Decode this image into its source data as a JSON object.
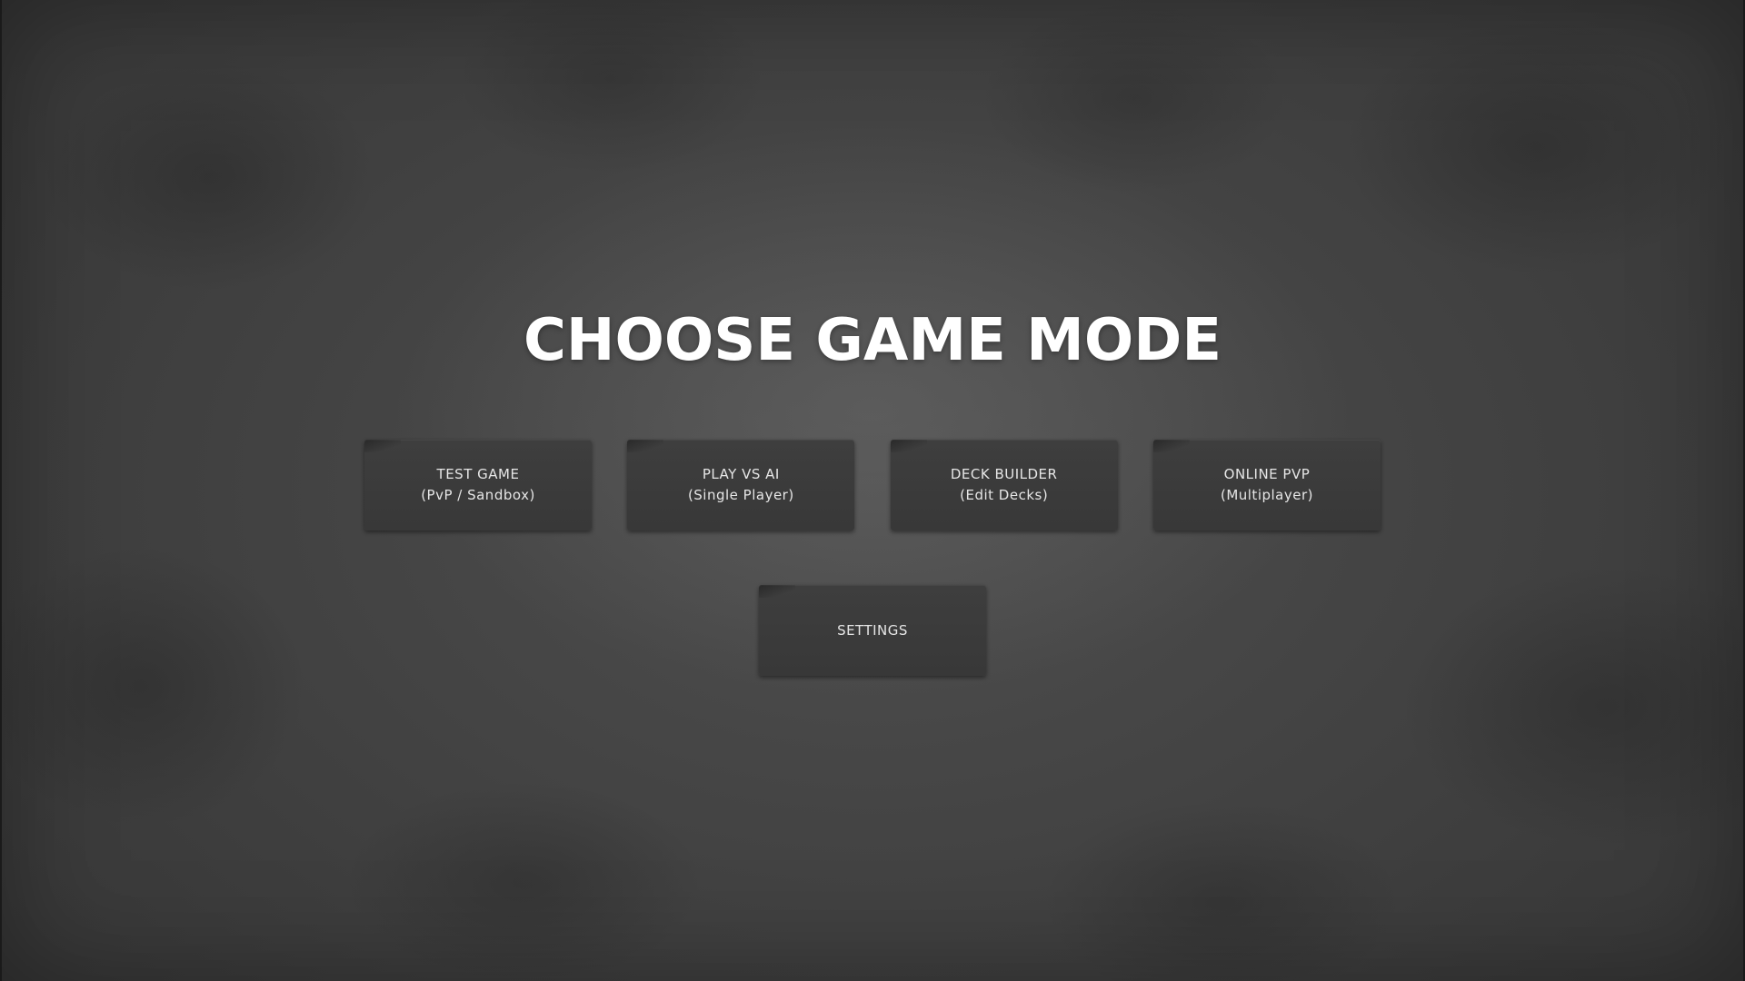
{
  "title": "CHOOSE GAME MODE",
  "modes": [
    {
      "label": "TEST GAME",
      "sublabel": "(PvP / Sandbox)"
    },
    {
      "label": "PLAY VS AI",
      "sublabel": "(Single Player)"
    },
    {
      "label": "DECK BUILDER",
      "sublabel": "(Edit Decks)"
    },
    {
      "label": "ONLINE PVP",
      "sublabel": "(Multiplayer)"
    }
  ],
  "settings": {
    "label": "SETTINGS"
  },
  "colors": {
    "background": "#4b4b4b",
    "button": "#3b3b3b",
    "text": "#ffffff"
  }
}
